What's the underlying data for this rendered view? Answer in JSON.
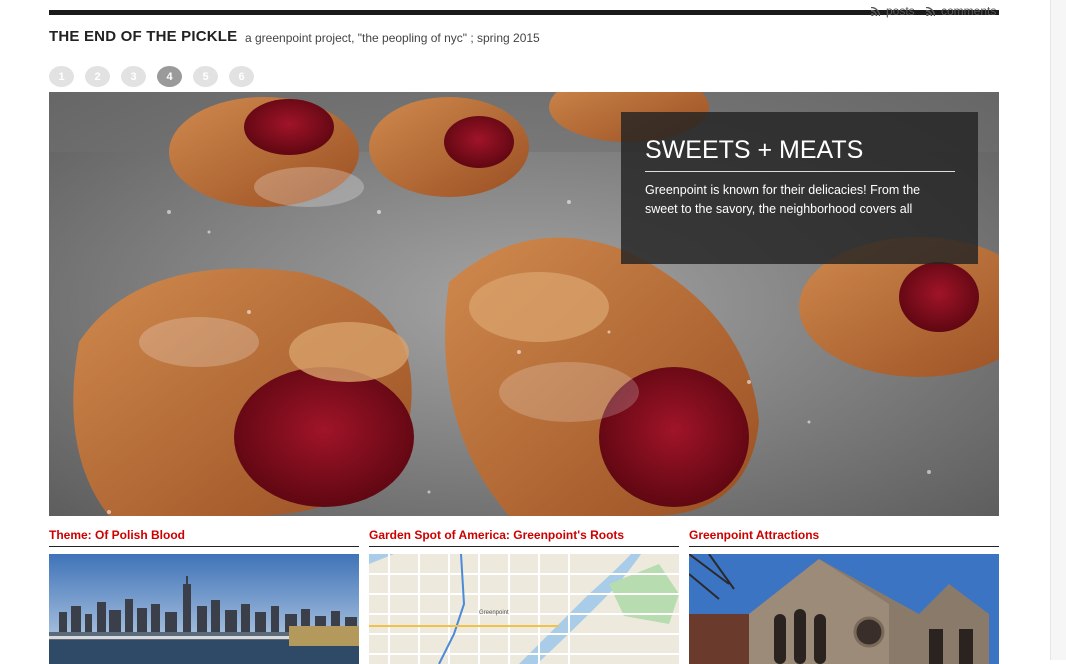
{
  "topbar": {
    "posts_label": "posts",
    "comments_label": "comments"
  },
  "site": {
    "title": "THE END OF THE PICKLE",
    "tagline": "a greenpoint project, \"the peopling of nyc\" ; spring 2015"
  },
  "pager": {
    "pages": [
      "1",
      "2",
      "3",
      "4",
      "5",
      "6"
    ],
    "active": "4"
  },
  "hero": {
    "title": "SWEETS + MEATS",
    "text": "Greenpoint is known for their delicacies! From the sweet to the savory, the neighborhood covers all"
  },
  "cards": [
    {
      "title": "Theme: Of Polish Blood"
    },
    {
      "title": "Garden Spot of America: Greenpoint's Roots"
    },
    {
      "title": "Greenpoint Attractions"
    }
  ],
  "map": {
    "labels": [
      "Greenpoint"
    ]
  },
  "colors": {
    "accent": "#cc0000",
    "topbar": "#1a1a1a",
    "caption_bg": "#232323"
  }
}
